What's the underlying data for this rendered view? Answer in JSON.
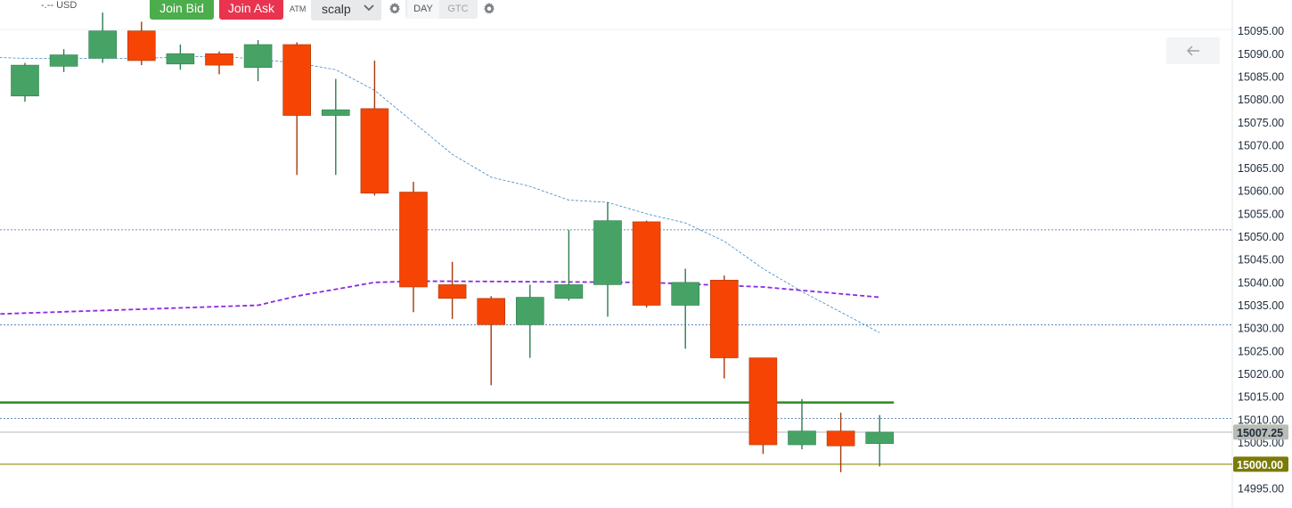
{
  "toolbar": {
    "price_text": "-.-- USD",
    "join_bid": "Join Bid",
    "join_ask": "Join Ask",
    "atm_label": "ATM",
    "strategy": "scalp",
    "tif_day": "DAY",
    "tif_gtc": "GTC"
  },
  "icons": {
    "dropdown": "chevron-down-icon",
    "settings": "gear-icon",
    "back": "arrow-left-icon"
  },
  "colors": {
    "up": "#46a365",
    "down": "#f64404",
    "wick_up": "#2e7d4f",
    "wick_down": "#a63a0a",
    "fast_ma": "#3d86c6",
    "slow_ma": "#8a2be2",
    "green_level": "#2e8b1f",
    "olive_level": "#9a9a1e",
    "last_price_badge": "#b9bcb5",
    "olive_badge": "#7a7a0a",
    "grid": "#3a6da8",
    "axis_text": "#1f2d3d"
  },
  "chart_data": {
    "type": "candlestick",
    "y_axis": {
      "ticks": [
        "15095.00",
        "15090.00",
        "15085.00",
        "15080.00",
        "15075.00",
        "15070.00",
        "15065.00",
        "15060.00",
        "15055.00",
        "15050.00",
        "15045.00",
        "15040.00",
        "15035.00",
        "15030.00",
        "15025.00",
        "15020.00",
        "15015.00",
        "15010.00",
        "15005.00",
        "15000.00",
        "14995.00"
      ],
      "range": [
        14993.4,
        15095.9
      ]
    },
    "candles": [
      {
        "o": 15080.75,
        "h": 15088.0,
        "l": 15079.5,
        "c": 15087.5
      },
      {
        "o": 15087.25,
        "h": 15091.0,
        "l": 15086.0,
        "c": 15089.75
      },
      {
        "o": 15089.0,
        "h": 15099.0,
        "l": 15088.0,
        "c": 15095.0
      },
      {
        "o": 15095.0,
        "h": 15097.0,
        "l": 15087.5,
        "c": 15088.5
      },
      {
        "o": 15087.75,
        "h": 15092.0,
        "l": 15086.5,
        "c": 15090.0
      },
      {
        "o": 15090.0,
        "h": 15090.5,
        "l": 15085.5,
        "c": 15087.5
      },
      {
        "o": 15087.0,
        "h": 15093.0,
        "l": 15084.0,
        "c": 15092.0
      },
      {
        "o": 15092.0,
        "h": 15092.5,
        "l": 15063.5,
        "c": 15076.5
      },
      {
        "o": 15076.5,
        "h": 15084.5,
        "l": 15063.5,
        "c": 15077.75
      },
      {
        "o": 15078.0,
        "h": 15088.5,
        "l": 15059.0,
        "c": 15059.5
      },
      {
        "o": 15059.75,
        "h": 15062.0,
        "l": 15033.5,
        "c": 15039.0
      },
      {
        "o": 15039.5,
        "h": 15044.5,
        "l": 15032.0,
        "c": 15036.5
      },
      {
        "o": 15036.5,
        "h": 15037.0,
        "l": 15017.5,
        "c": 15030.75
      },
      {
        "o": 15030.75,
        "h": 15039.5,
        "l": 15023.5,
        "c": 15036.75
      },
      {
        "o": 15036.5,
        "h": 15051.5,
        "l": 15036.0,
        "c": 15039.5
      },
      {
        "o": 15039.5,
        "h": 15057.5,
        "l": 15032.5,
        "c": 15053.5
      },
      {
        "o": 15053.25,
        "h": 15053.5,
        "l": 15034.5,
        "c": 15035.0
      },
      {
        "o": 15035.0,
        "h": 15043.0,
        "l": 15025.5,
        "c": 15040.0
      },
      {
        "o": 15040.5,
        "h": 15041.5,
        "l": 15019.0,
        "c": 15023.5
      },
      {
        "o": 15023.5,
        "h": 15023.5,
        "l": 15002.5,
        "c": 15004.5
      },
      {
        "o": 15004.5,
        "h": 15014.5,
        "l": 15003.5,
        "c": 15007.5
      },
      {
        "o": 15007.5,
        "h": 15011.5,
        "l": 14998.5,
        "c": 15004.25
      },
      {
        "o": 15004.75,
        "h": 15011.0,
        "l": 14999.75,
        "c": 15007.25
      }
    ],
    "moving_averages": [
      {
        "style": "thin-dashed",
        "points": [
          [
            -1,
            15089.25
          ],
          [
            0,
            15089.0
          ],
          [
            3,
            15089.0
          ],
          [
            5,
            15089.5
          ],
          [
            7,
            15088.0
          ],
          [
            8,
            15086.5
          ],
          [
            9,
            15082.0
          ],
          [
            10,
            15075.0
          ],
          [
            11,
            15068.0
          ],
          [
            12,
            15063.0
          ],
          [
            13,
            15061.0
          ],
          [
            14,
            15058.0
          ],
          [
            15,
            15057.5
          ],
          [
            16,
            15055.0
          ],
          [
            17,
            15053.0
          ],
          [
            18,
            15049.0
          ],
          [
            19,
            15043.0
          ],
          [
            20,
            15038.0
          ],
          [
            21,
            15033.5
          ],
          [
            22,
            15029.0
          ]
        ]
      },
      {
        "style": "thick-dashed",
        "points": [
          [
            -1,
            15033.0
          ],
          [
            6,
            15035.0
          ],
          [
            7,
            15037.0
          ],
          [
            9,
            15040.0
          ],
          [
            10,
            15040.25
          ],
          [
            11,
            15040.25
          ],
          [
            16,
            15040.0
          ],
          [
            19,
            15039.0
          ],
          [
            22,
            15036.75
          ]
        ]
      }
    ],
    "levels": [
      {
        "value": 15051.5,
        "style": "dashed"
      },
      {
        "value": 15030.75,
        "style": "dashed"
      },
      {
        "value": 15010.25,
        "style": "dashed"
      },
      {
        "value": 15013.75,
        "style": "solid-green"
      },
      {
        "value": 15007.25,
        "style": "solid-gray",
        "label": "15007.25"
      },
      {
        "value": 15000.25,
        "style": "solid-olive",
        "label": "15000.00"
      }
    ]
  }
}
